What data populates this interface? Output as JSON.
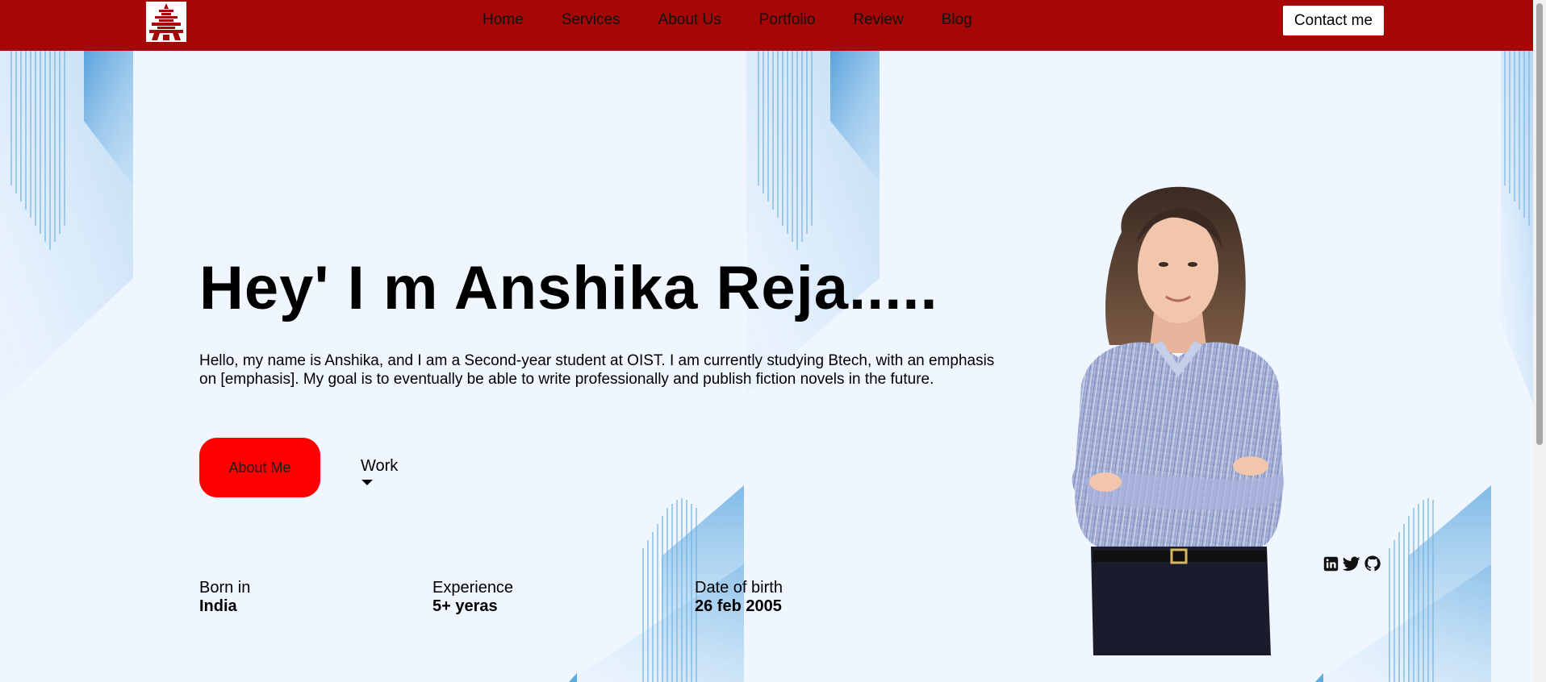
{
  "nav": {
    "logo_icon": "pagoda-logo-icon",
    "links": [
      "Home",
      "Services",
      "About Us",
      "Portfolio",
      "Review",
      "Blog"
    ],
    "contact_label": "Contact me"
  },
  "hero": {
    "title": "Hey' I m Anshika Reja.....",
    "description": "Hello, my name is Anshika, and I am a Second-year student at OIST. I am currently studying Btech, with an emphasis on [emphasis]. My goal is to eventually be able to write professionally and publish fiction novels in the future.",
    "about_button": "About Me",
    "work_label": "Work"
  },
  "info": {
    "born_label": "Born in",
    "born_value": "India",
    "experience_label": "Experience",
    "experience_value": "5+ yeras",
    "dob_label": "Date of birth",
    "dob_value": "26 feb 2005"
  },
  "socials": [
    "linkedin-icon",
    "twitter-icon",
    "github-icon"
  ],
  "colors": {
    "navbar": "#a50606",
    "accent_button": "#ff0000",
    "background": "#eff6ff",
    "decor_blue": "#3b8fd4"
  }
}
